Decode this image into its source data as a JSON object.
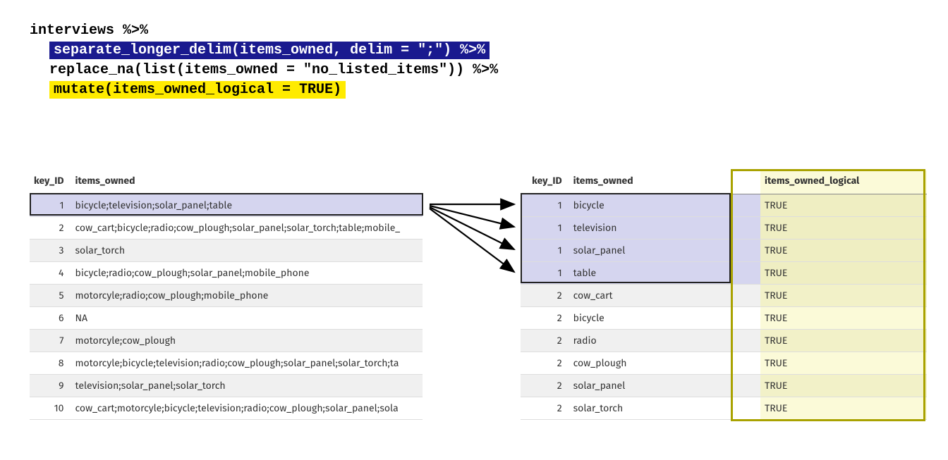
{
  "code": {
    "line1": "interviews %>%",
    "line2": "separate_longer_delim(items_owned, delim = \";\") %>%",
    "line3": "replace_na(list(items_owned = \"no_listed_items\")) %>%",
    "line4": "mutate(items_owned_logical = TRUE)"
  },
  "headers": {
    "key_id": "key_ID",
    "items_owned": "items_owned",
    "items_owned_logical": "items_owned_logical"
  },
  "left_rows": [
    {
      "id": "1",
      "items": "bicycle;television;solar_panel;table"
    },
    {
      "id": "2",
      "items": "cow_cart;bicycle;radio;cow_plough;solar_panel;solar_torch;table;mobile_"
    },
    {
      "id": "3",
      "items": "solar_torch"
    },
    {
      "id": "4",
      "items": "bicycle;radio;cow_plough;solar_panel;mobile_phone"
    },
    {
      "id": "5",
      "items": "motorcyle;radio;cow_plough;mobile_phone"
    },
    {
      "id": "6",
      "items": "NA"
    },
    {
      "id": "7",
      "items": "motorcyle;cow_plough"
    },
    {
      "id": "8",
      "items": "motorcyle;bicycle;television;radio;cow_plough;solar_panel;solar_torch;ta"
    },
    {
      "id": "9",
      "items": "television;solar_panel;solar_torch"
    },
    {
      "id": "10",
      "items": "cow_cart;motorcyle;bicycle;television;radio;cow_plough;solar_panel;sola"
    }
  ],
  "right_rows": [
    {
      "id": "1",
      "items": "bicycle",
      "logical": "TRUE"
    },
    {
      "id": "1",
      "items": "television",
      "logical": "TRUE"
    },
    {
      "id": "1",
      "items": "solar_panel",
      "logical": "TRUE"
    },
    {
      "id": "1",
      "items": "table",
      "logical": "TRUE"
    },
    {
      "id": "2",
      "items": "cow_cart",
      "logical": "TRUE"
    },
    {
      "id": "2",
      "items": "bicycle",
      "logical": "TRUE"
    },
    {
      "id": "2",
      "items": "radio",
      "logical": "TRUE"
    },
    {
      "id": "2",
      "items": "cow_plough",
      "logical": "TRUE"
    },
    {
      "id": "2",
      "items": "solar_panel",
      "logical": "TRUE"
    },
    {
      "id": "2",
      "items": "solar_torch",
      "logical": "TRUE"
    }
  ],
  "colors": {
    "highlight_blue": "#1a1a8f",
    "highlight_yellow": "#ffeb00",
    "row_purple": "#d5d5ef",
    "col_yellow": "#fbfad8",
    "yellow_border": "#a9a200"
  }
}
